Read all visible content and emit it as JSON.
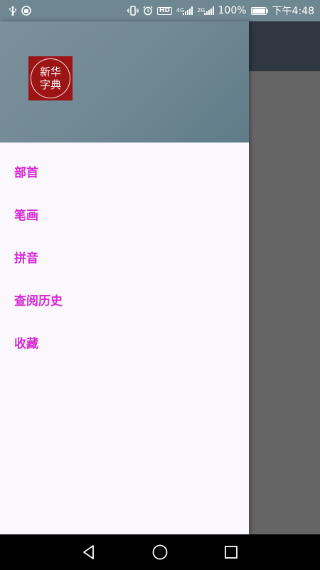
{
  "status_bar": {
    "battery_percent": "100%",
    "time": "下午4:48",
    "network_a": "4G",
    "network_b": "2G",
    "hd_label": "HD",
    "battery_level": 1.0
  },
  "drawer": {
    "logo_line1": "新华",
    "logo_line2": "字典",
    "menu_items": [
      {
        "label": "部首"
      },
      {
        "label": "笔画"
      },
      {
        "label": "拼音"
      },
      {
        "label": "查阅历史"
      },
      {
        "label": "收藏"
      }
    ]
  },
  "colors": {
    "menu_text": "#d62ad6",
    "logo_bg": "#9c1414",
    "header_bg": "#6f8893",
    "toolbar_bg": "#2f3741",
    "scrim": "#666566"
  },
  "nav_bar": {
    "back_icon": "back-triangle-icon",
    "home_icon": "home-circle-icon",
    "recents_icon": "recents-square-icon"
  }
}
